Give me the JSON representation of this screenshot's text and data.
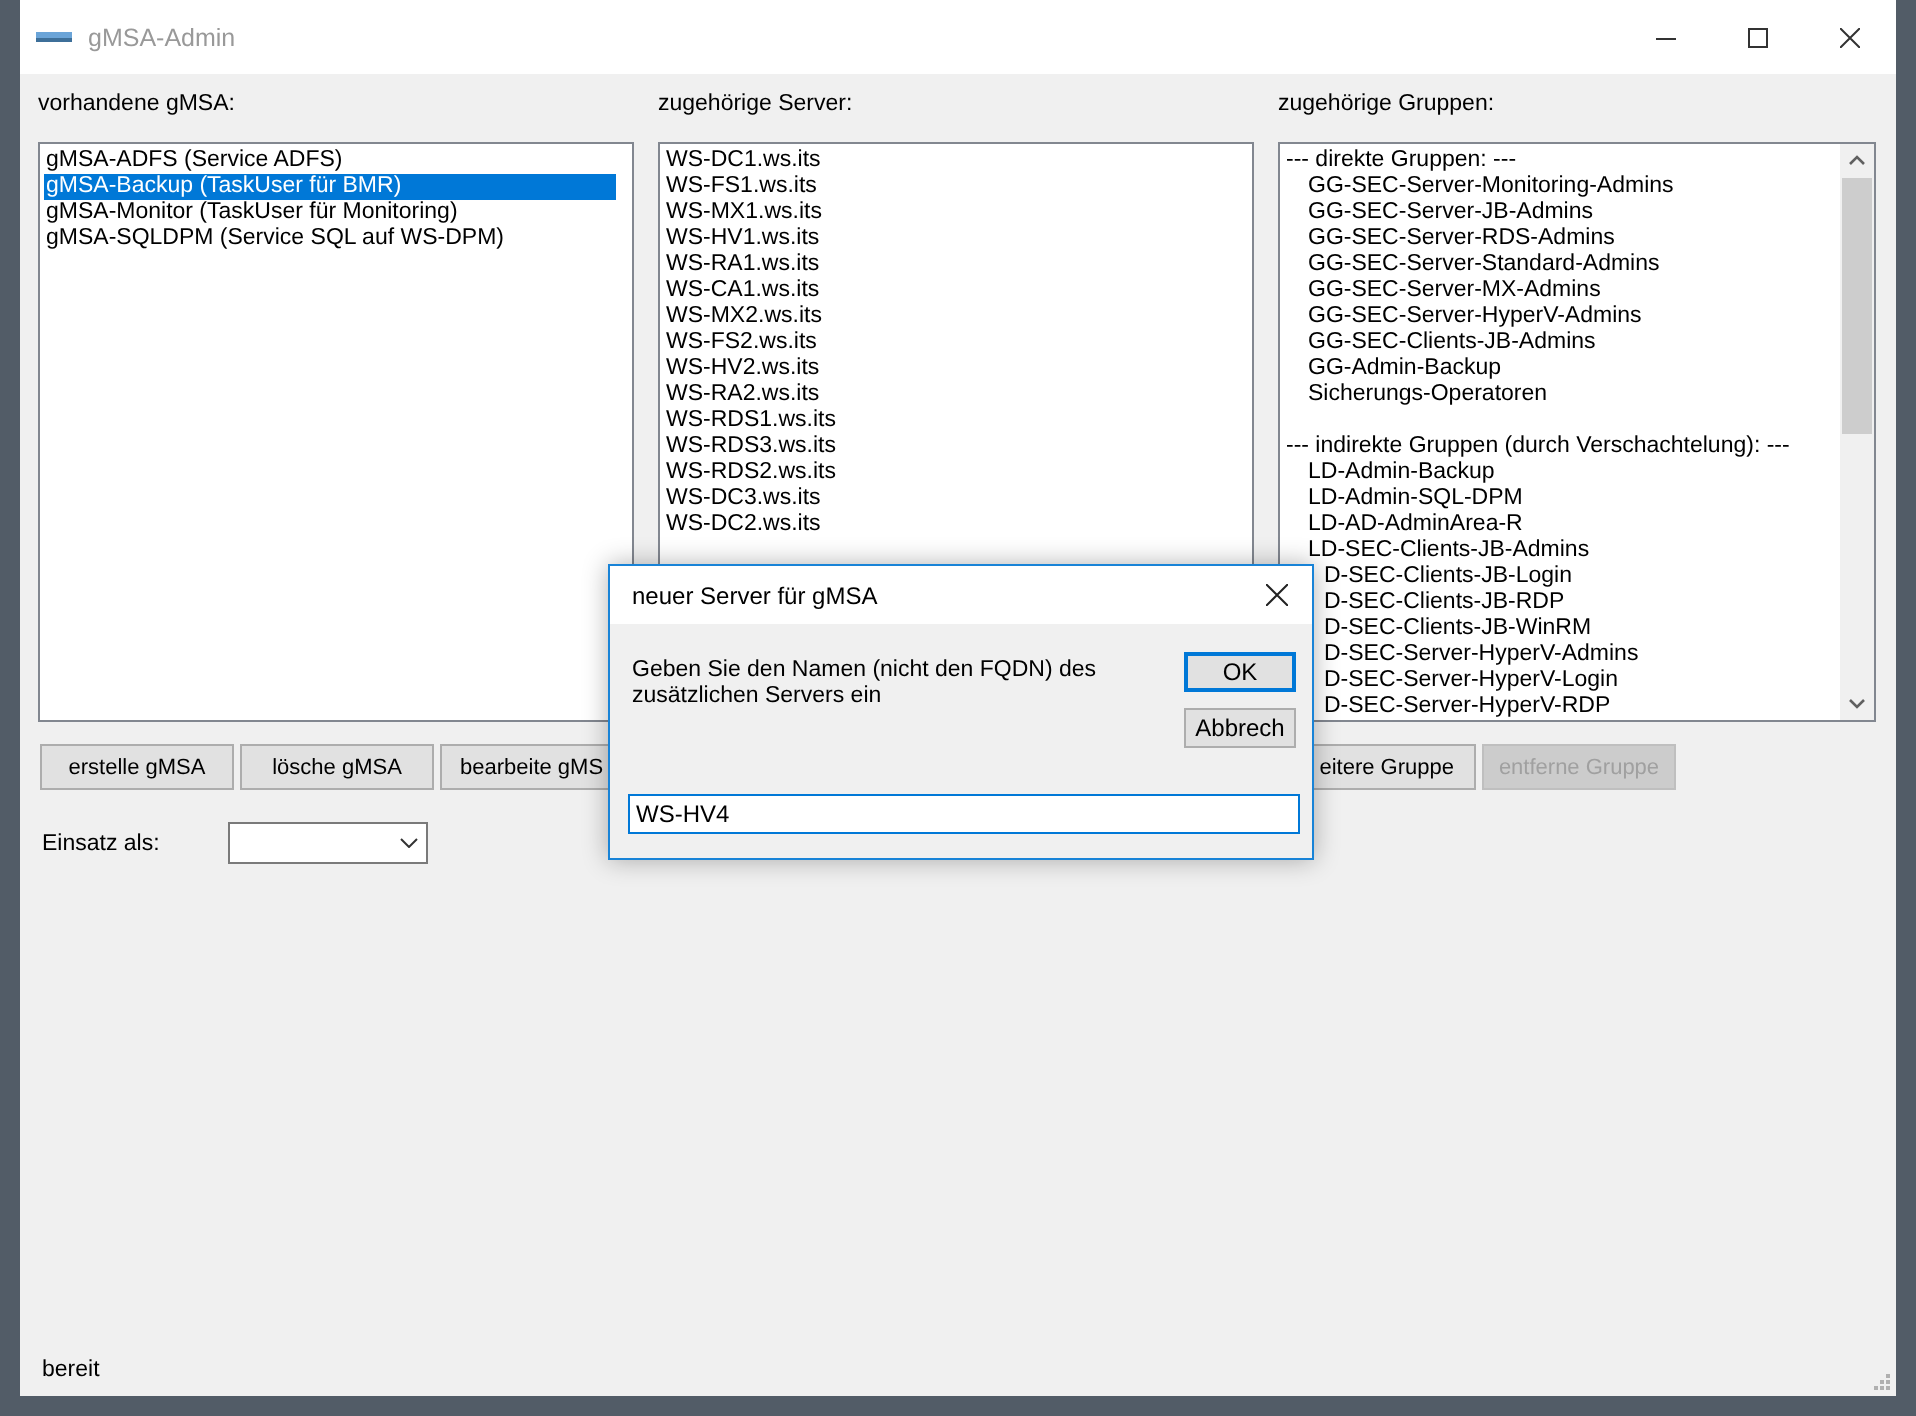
{
  "window": {
    "title": "gMSA-Admin"
  },
  "columns": {
    "gmsa_label": "vorhandene gMSA:",
    "server_label": "zugehörige Server:",
    "groups_label": "zugehörige Gruppen:"
  },
  "gmsa_list": [
    {
      "text": "gMSA-ADFS (Service ADFS)",
      "selected": false
    },
    {
      "text": "gMSA-Backup (TaskUser für BMR)",
      "selected": true
    },
    {
      "text": "gMSA-Monitor (TaskUser für Monitoring)",
      "selected": false
    },
    {
      "text": "gMSA-SQLDPM (Service SQL auf WS-DPM)",
      "selected": false
    }
  ],
  "server_list": [
    "WS-DC1.ws.its",
    "WS-FS1.ws.its",
    "WS-MX1.ws.its",
    "WS-HV1.ws.its",
    "WS-RA1.ws.its",
    "WS-CA1.ws.its",
    "WS-MX2.ws.its",
    "WS-FS2.ws.its",
    "WS-HV2.ws.its",
    "WS-RA2.ws.its",
    "WS-RDS1.ws.its",
    "WS-RDS3.ws.its",
    "WS-RDS2.ws.its",
    "WS-DC3.ws.its",
    "WS-DC2.ws.its"
  ],
  "group_sections": [
    {
      "header": "--- direkte Gruppen: ---",
      "items": [
        {
          "text": "GG-SEC-Server-Monitoring-Admins",
          "partly_hidden": false
        },
        {
          "text": "GG-SEC-Server-JB-Admins",
          "partly_hidden": false
        },
        {
          "text": "GG-SEC-Server-RDS-Admins",
          "partly_hidden": false
        },
        {
          "text": "GG-SEC-Server-Standard-Admins",
          "partly_hidden": false
        },
        {
          "text": "GG-SEC-Server-MX-Admins",
          "partly_hidden": false
        },
        {
          "text": "GG-SEC-Server-HyperV-Admins",
          "partly_hidden": false
        },
        {
          "text": "GG-SEC-Clients-JB-Admins",
          "partly_hidden": false
        },
        {
          "text": "GG-Admin-Backup",
          "partly_hidden": false
        },
        {
          "text": "Sicherungs-Operatoren",
          "partly_hidden": false
        }
      ]
    },
    {
      "header": "--- indirekte Gruppen (durch Verschachtelung): ---",
      "items": [
        {
          "text": "LD-Admin-Backup",
          "partly_hidden": false
        },
        {
          "text": "LD-Admin-SQL-DPM",
          "partly_hidden": false
        },
        {
          "text": "LD-AD-AdminArea-R",
          "partly_hidden": false
        },
        {
          "text": "LD-SEC-Clients-JB-Admins",
          "partly_hidden": false
        },
        {
          "text": "D-SEC-Clients-JB-Login",
          "partly_hidden": true
        },
        {
          "text": "D-SEC-Clients-JB-RDP",
          "partly_hidden": true
        },
        {
          "text": "D-SEC-Clients-JB-WinRM",
          "partly_hidden": true
        },
        {
          "text": "D-SEC-Server-HyperV-Admins",
          "partly_hidden": true
        },
        {
          "text": "D-SEC-Server-HyperV-Login",
          "partly_hidden": true
        },
        {
          "text": "D-SEC-Server-HyperV-RDP",
          "partly_hidden": true
        }
      ]
    }
  ],
  "gmsa_buttons": [
    {
      "label": "erstelle gMSA",
      "disabled": false
    },
    {
      "label": "lösche gMSA",
      "disabled": false
    },
    {
      "label": "bearbeite gMS",
      "disabled": false
    }
  ],
  "group_buttons": [
    {
      "label": "eitere Gruppe",
      "disabled": false
    },
    {
      "label": "entferne Gruppe",
      "disabled": true
    }
  ],
  "usage": {
    "label": "Einsatz als:"
  },
  "status_bar": "bereit",
  "dialog": {
    "title": "neuer Server für gMSA",
    "message": "Geben Sie den Namen (nicht den FQDN) des zusätzlichen Servers ein",
    "value": "WS-HV4",
    "buttons": [
      {
        "label": "OK",
        "default": true
      },
      {
        "label": "Abbrech",
        "default": false
      }
    ]
  }
}
